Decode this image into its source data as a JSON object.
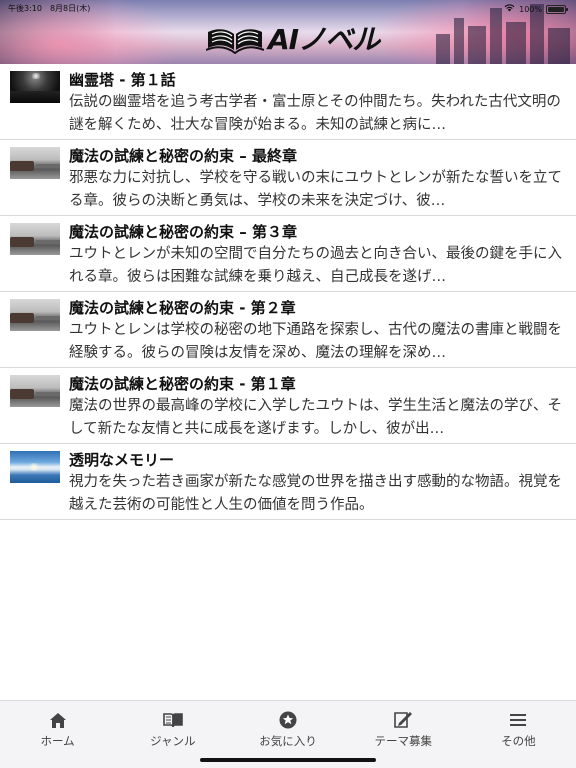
{
  "status_bar": {
    "time": "午後3:10　8月8日(木)",
    "battery": "100%"
  },
  "header": {
    "logo_text": "AIノベル"
  },
  "stories": [
    {
      "title": "幽霊塔 - 第１話",
      "description": "伝説の幽霊塔を追う考古学者・富士原とその仲間たち。失われた古代文明の謎を解くため、壮大な冒険が始まる。未知の試練と病に…",
      "thumbnail": "dark-room-lamp"
    },
    {
      "title": "魔法の試練と秘密の約束 – 最終章",
      "description": "邪悪な力に対抗し、学校を守る戦いの末にユウトとレンが新たな誓いを立てる章。彼らの決断と勇気は、学校の未来を決定づけ、彼…",
      "thumbnail": "misty-lake"
    },
    {
      "title": "魔法の試練と秘密の約束 – 第３章",
      "description": "ユウトとレンが未知の空間で自分たちの過去と向き合い、最後の鍵を手に入れる章。彼らは困難な試練を乗り越え、自己成長を遂げ…",
      "thumbnail": "misty-lake"
    },
    {
      "title": "魔法の試練と秘密の約束 - 第２章",
      "description": "ユウトとレンは学校の秘密の地下通路を探索し、古代の魔法の書庫と戦闘を経験する。彼らの冒険は友情を深め、魔法の理解を深め…",
      "thumbnail": "misty-lake"
    },
    {
      "title": "魔法の試練と秘密の約束 - 第１章",
      "description": "魔法の世界の最高峰の学校に入学したユウトは、学生生活と魔法の学び、そして新たな友情と共に成長を遂げます。しかし、彼が出…",
      "thumbnail": "misty-lake"
    },
    {
      "title": "透明なメモリー",
      "description": "視力を失った若き画家が新たな感覚の世界を描き出す感動的な物語。視覚を越えた芸術の可能性と人生の価値を問う作品。",
      "thumbnail": "sky-horizon"
    }
  ],
  "tabs": [
    {
      "label": "ホーム",
      "icon": "home-icon"
    },
    {
      "label": "ジャンル",
      "icon": "book-icon"
    },
    {
      "label": "お気に入り",
      "icon": "star-icon"
    },
    {
      "label": "テーマ募集",
      "icon": "edit-icon"
    },
    {
      "label": "その他",
      "icon": "menu-icon"
    }
  ]
}
